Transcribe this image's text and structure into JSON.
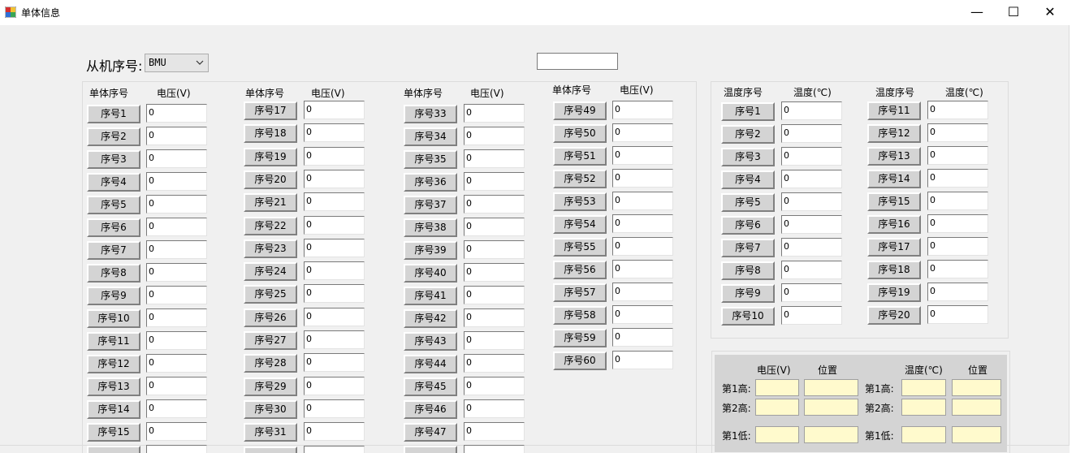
{
  "window": {
    "title": "单体信息",
    "minimize": "—",
    "maximize": "☐",
    "close": "✕"
  },
  "slave": {
    "label": "从机序号:",
    "selected": "BMU",
    "extra_input": ""
  },
  "voltage_groups": [
    {
      "header_id": "单体序号",
      "header_value": "电压(V)",
      "cells": [
        {
          "label": "序号1",
          "value": "0"
        },
        {
          "label": "序号2",
          "value": "0"
        },
        {
          "label": "序号3",
          "value": "0"
        },
        {
          "label": "序号4",
          "value": "0"
        },
        {
          "label": "序号5",
          "value": "0"
        },
        {
          "label": "序号6",
          "value": "0"
        },
        {
          "label": "序号7",
          "value": "0"
        },
        {
          "label": "序号8",
          "value": "0"
        },
        {
          "label": "序号9",
          "value": "0"
        },
        {
          "label": "序号10",
          "value": "0"
        },
        {
          "label": "序号11",
          "value": "0"
        },
        {
          "label": "序号12",
          "value": "0"
        },
        {
          "label": "序号13",
          "value": "0"
        },
        {
          "label": "序号14",
          "value": "0"
        },
        {
          "label": "序号15",
          "value": "0"
        }
      ]
    },
    {
      "header_id": "单体序号",
      "header_value": "电压(V)",
      "cells": [
        {
          "label": "序号17",
          "value": "0"
        },
        {
          "label": "序号18",
          "value": "0"
        },
        {
          "label": "序号19",
          "value": "0"
        },
        {
          "label": "序号20",
          "value": "0"
        },
        {
          "label": "序号21",
          "value": "0"
        },
        {
          "label": "序号22",
          "value": "0"
        },
        {
          "label": "序号23",
          "value": "0"
        },
        {
          "label": "序号24",
          "value": "0"
        },
        {
          "label": "序号25",
          "value": "0"
        },
        {
          "label": "序号26",
          "value": "0"
        },
        {
          "label": "序号27",
          "value": "0"
        },
        {
          "label": "序号28",
          "value": "0"
        },
        {
          "label": "序号29",
          "value": "0"
        },
        {
          "label": "序号30",
          "value": "0"
        },
        {
          "label": "序号31",
          "value": "0"
        }
      ]
    },
    {
      "header_id": "单体序号",
      "header_value": "电压(V)",
      "cells": [
        {
          "label": "序号33",
          "value": "0"
        },
        {
          "label": "序号34",
          "value": "0"
        },
        {
          "label": "序号35",
          "value": "0"
        },
        {
          "label": "序号36",
          "value": "0"
        },
        {
          "label": "序号37",
          "value": "0"
        },
        {
          "label": "序号38",
          "value": "0"
        },
        {
          "label": "序号39",
          "value": "0"
        },
        {
          "label": "序号40",
          "value": "0"
        },
        {
          "label": "序号41",
          "value": "0"
        },
        {
          "label": "序号42",
          "value": "0"
        },
        {
          "label": "序号43",
          "value": "0"
        },
        {
          "label": "序号44",
          "value": "0"
        },
        {
          "label": "序号45",
          "value": "0"
        },
        {
          "label": "序号46",
          "value": "0"
        },
        {
          "label": "序号47",
          "value": "0"
        }
      ]
    },
    {
      "header_id": "单体序号",
      "header_value": "电压(V)",
      "cells": [
        {
          "label": "序号49",
          "value": "0"
        },
        {
          "label": "序号50",
          "value": "0"
        },
        {
          "label": "序号51",
          "value": "0"
        },
        {
          "label": "序号52",
          "value": "0"
        },
        {
          "label": "序号53",
          "value": "0"
        },
        {
          "label": "序号54",
          "value": "0"
        },
        {
          "label": "序号55",
          "value": "0"
        },
        {
          "label": "序号56",
          "value": "0"
        },
        {
          "label": "序号57",
          "value": "0"
        },
        {
          "label": "序号58",
          "value": "0"
        },
        {
          "label": "序号59",
          "value": "0"
        },
        {
          "label": "序号60",
          "value": "0"
        }
      ]
    }
  ],
  "temperature_groups": [
    {
      "header_id": "温度序号",
      "header_value": "温度(℃)",
      "cells": [
        {
          "label": "序号1",
          "value": "0"
        },
        {
          "label": "序号2",
          "value": "0"
        },
        {
          "label": "序号3",
          "value": "0"
        },
        {
          "label": "序号4",
          "value": "0"
        },
        {
          "label": "序号5",
          "value": "0"
        },
        {
          "label": "序号6",
          "value": "0"
        },
        {
          "label": "序号7",
          "value": "0"
        },
        {
          "label": "序号8",
          "value": "0"
        },
        {
          "label": "序号9",
          "value": "0"
        },
        {
          "label": "序号10",
          "value": "0"
        }
      ]
    },
    {
      "header_id": "温度序号",
      "header_value": "温度(℃)",
      "cells": [
        {
          "label": "序号11",
          "value": "0"
        },
        {
          "label": "序号12",
          "value": "0"
        },
        {
          "label": "序号13",
          "value": "0"
        },
        {
          "label": "序号14",
          "value": "0"
        },
        {
          "label": "序号15",
          "value": "0"
        },
        {
          "label": "序号16",
          "value": "0"
        },
        {
          "label": "序号17",
          "value": "0"
        },
        {
          "label": "序号18",
          "value": "0"
        },
        {
          "label": "序号19",
          "value": "0"
        },
        {
          "label": "序号20",
          "value": "0"
        }
      ]
    }
  ],
  "summary": {
    "voltage_header": "电压(V)",
    "position_header": "位置",
    "temp_header": "温度(℃)",
    "rows": [
      {
        "label": "第1高:",
        "temp_label": "第1高:"
      },
      {
        "label": "第2高:",
        "temp_label": "第2高:"
      },
      {
        "label": "第1低:",
        "temp_label": "第1低:"
      }
    ]
  }
}
